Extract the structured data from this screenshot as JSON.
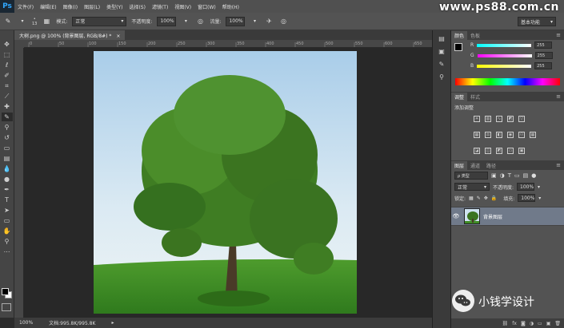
{
  "app": {
    "logo_text": "Ps"
  },
  "menubar": {
    "items": [
      "文件(F)",
      "编辑(E)",
      "图像(I)",
      "图层(L)",
      "类型(Y)",
      "选择(S)",
      "滤镜(T)",
      "视图(V)",
      "窗口(W)",
      "帮助(H)"
    ],
    "watermark": "www.ps88.com.cn"
  },
  "options_bar": {
    "brush_size": "13",
    "mode_label": "模式:",
    "mode_value": "正常",
    "opacity_label": "不透明度:",
    "opacity_value": "100%",
    "flow_label": "流量:",
    "flow_value": "100%",
    "workspace": "基本功能"
  },
  "document": {
    "tab_title": "大树.png @ 100% (背景图层, RGB/8#) *",
    "zoom": "100%",
    "doc_info": "文档:995.8K/995.8K"
  },
  "ruler_ticks": [
    "0",
    "50",
    "100",
    "150",
    "200",
    "250",
    "300",
    "350",
    "400",
    "450",
    "500",
    "550",
    "600",
    "650"
  ],
  "color_panel": {
    "tabs": [
      "颜色",
      "色板"
    ],
    "channels": [
      {
        "label": "R",
        "value": "255",
        "color": "#ff4040"
      },
      {
        "label": "G",
        "value": "255",
        "color": "#e040e0"
      },
      {
        "label": "B",
        "value": "255",
        "color": "#e0e040"
      }
    ]
  },
  "adjustments_panel": {
    "tabs": [
      "调整",
      "样式"
    ],
    "title": "添加调整"
  },
  "layers_panel": {
    "tabs": [
      "图层",
      "通道",
      "路径"
    ],
    "kind_label": "ρ 类型",
    "blend_mode": "正常",
    "opacity_label": "不透明度:",
    "opacity_value": "100%",
    "lock_label": "锁定:",
    "fill_label": "填充:",
    "fill_value": "100%",
    "layers": [
      {
        "name": "背景图层",
        "visible": true
      }
    ]
  },
  "overlay": {
    "wechat_text": "小钱学设计"
  }
}
